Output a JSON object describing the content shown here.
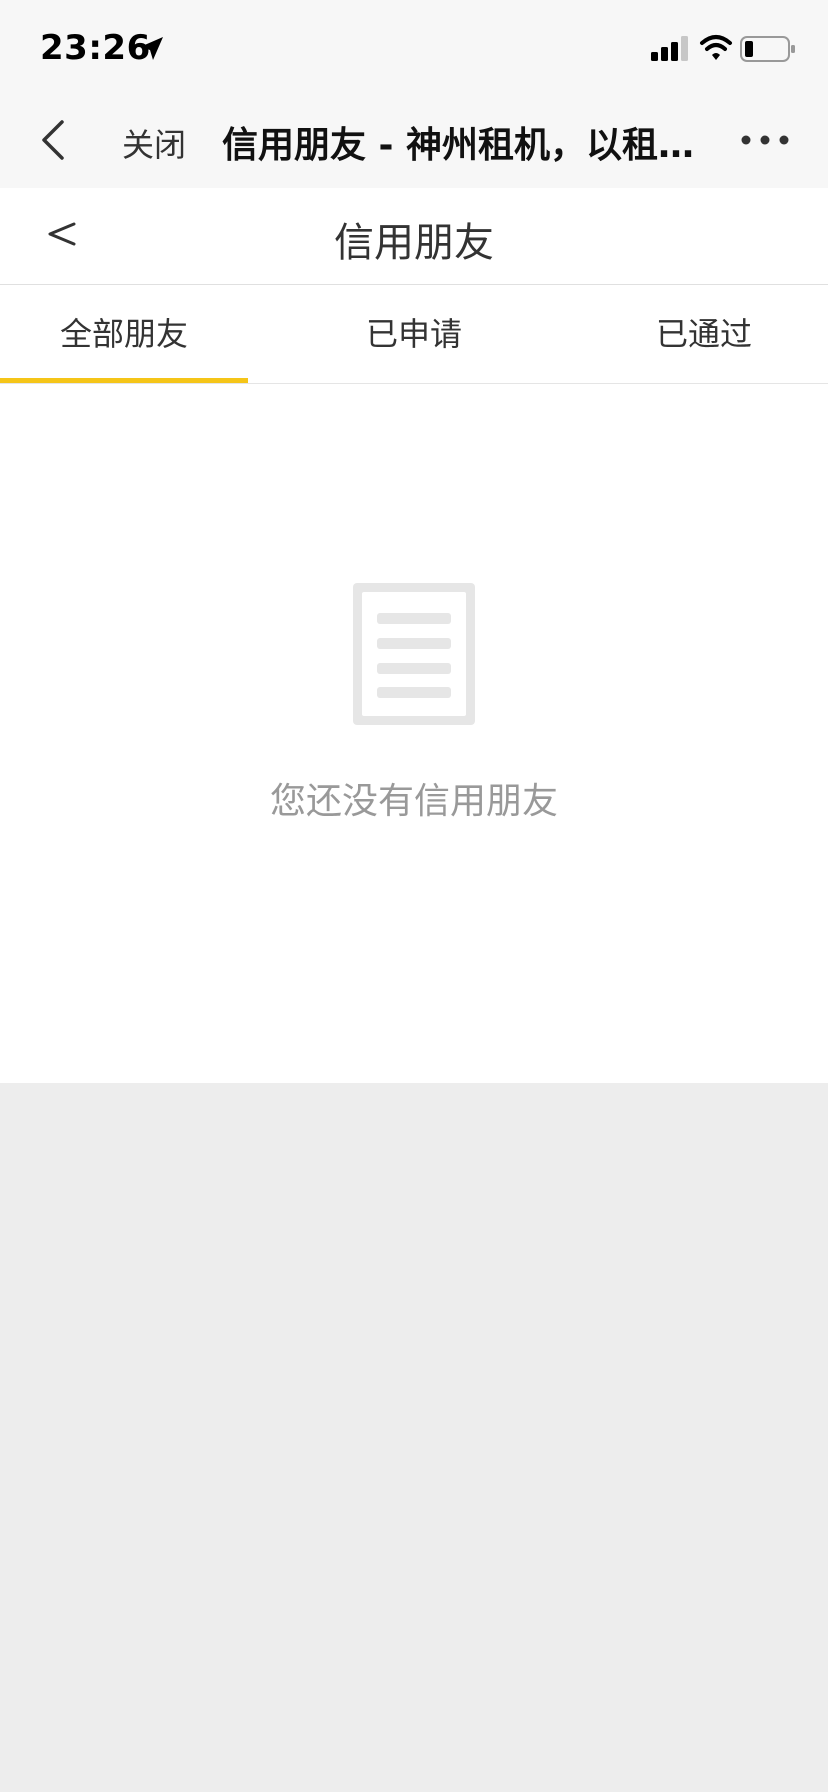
{
  "status_bar": {
    "time": "23:26",
    "icons": [
      "location-icon",
      "signal-icon",
      "wifi-icon",
      "battery-icon"
    ]
  },
  "title_bar": {
    "back_icon": "chevron-left-icon",
    "close_label": "关闭",
    "title": "信用朋友 - 神州租机，以租…",
    "more_icon": "more-dots-icon"
  },
  "page_header": {
    "back_icon": "chevron-left-icon",
    "title": "信用朋友"
  },
  "tabs": [
    {
      "label": "全部朋友",
      "active": true
    },
    {
      "label": "已申请",
      "active": false
    },
    {
      "label": "已通过",
      "active": false
    }
  ],
  "empty_state": {
    "icon": "document-icon",
    "message": "您还没有信用朋友"
  },
  "colors": {
    "accent": "#f5c518",
    "background": "#ededed",
    "muted_text": "#999999"
  }
}
